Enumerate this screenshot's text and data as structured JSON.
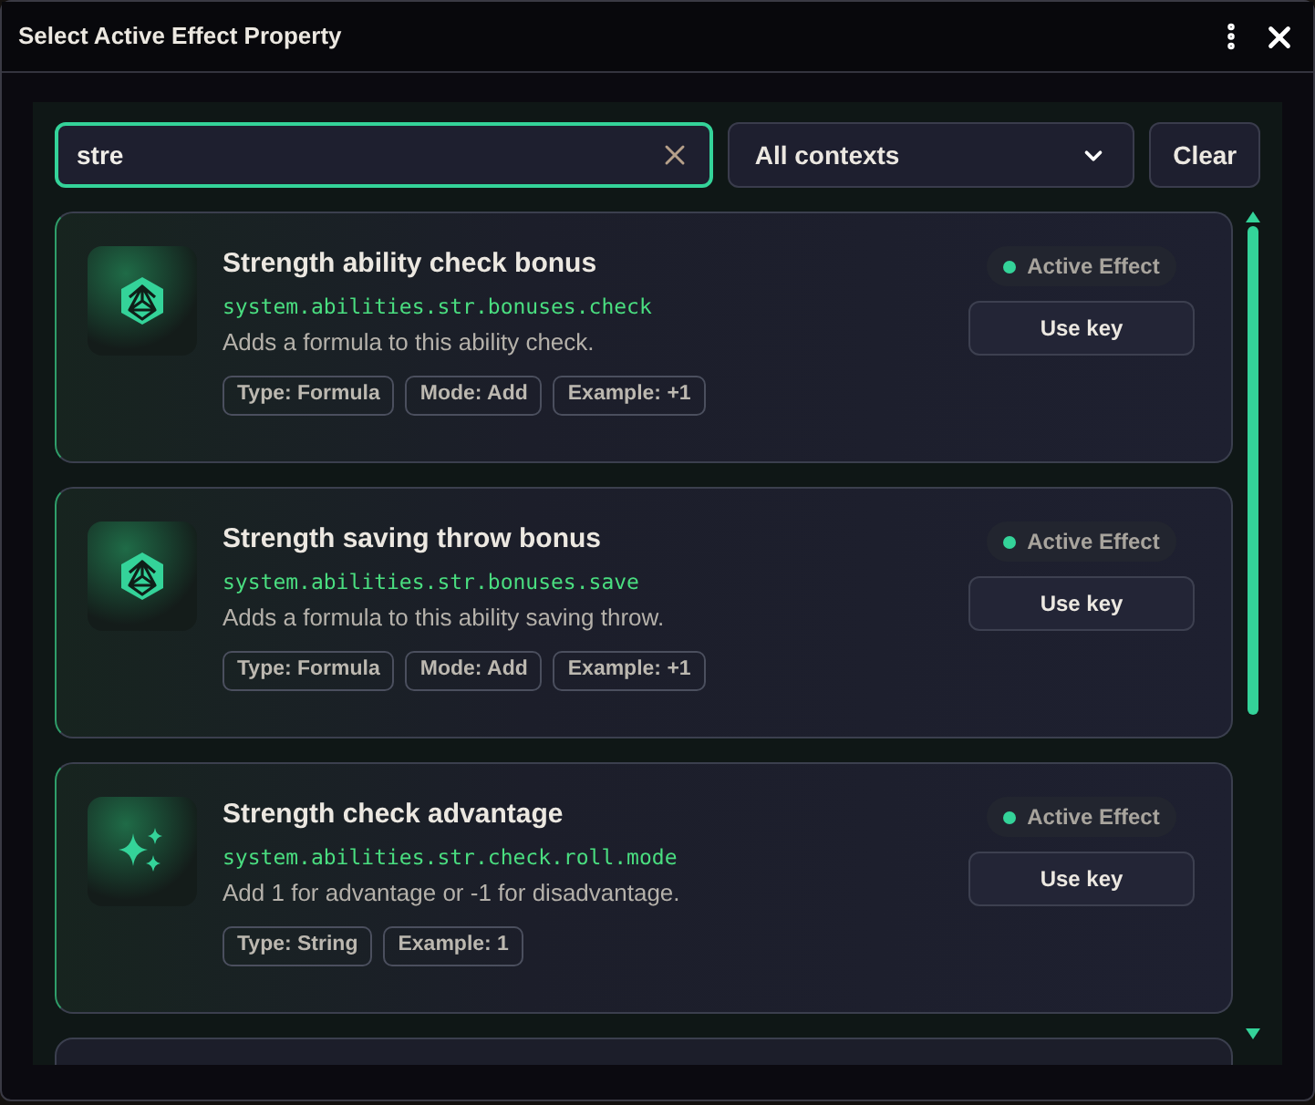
{
  "window": {
    "title": "Select Active Effect Property"
  },
  "search": {
    "value": "stre"
  },
  "context_select": {
    "value": "All contexts"
  },
  "clear_button": "Clear",
  "results": [
    {
      "kind": "d20",
      "title": "Strength ability check bonus",
      "key": "system.abilities.str.bonuses.check",
      "description": "Adds a formula to this ability check.",
      "tags": [
        "Type: Formula",
        "Mode: Add",
        "Example: +1"
      ],
      "badge": "Active Effect",
      "action": "Use key"
    },
    {
      "kind": "d20",
      "title": "Strength saving throw bonus",
      "key": "system.abilities.str.bonuses.save",
      "description": "Adds a formula to this ability saving throw.",
      "tags": [
        "Type: Formula",
        "Mode: Add",
        "Example: +1"
      ],
      "badge": "Active Effect",
      "action": "Use key"
    },
    {
      "kind": "sparkles",
      "title": "Strength check advantage",
      "key": "system.abilities.str.check.roll.mode",
      "description": "Add 1 for advantage or -1 for disadvantage.",
      "tags": [
        "Type: String",
        "Example: 1"
      ],
      "badge": "Active Effect",
      "action": "Use key"
    }
  ]
}
